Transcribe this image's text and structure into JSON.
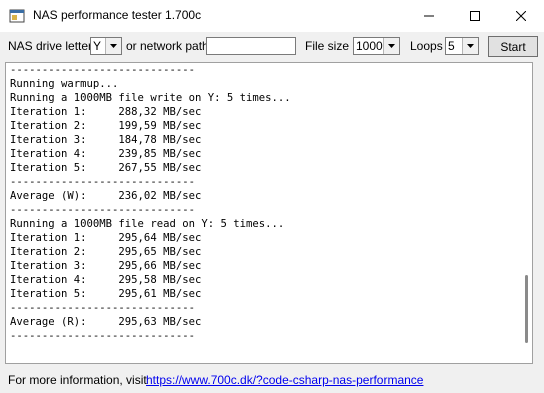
{
  "window": {
    "title": "NAS performance tester 1.700c",
    "icons": {
      "app": "app-window-icon",
      "minimize": "minimize-icon",
      "maximize": "maximize-icon",
      "close": "close-icon"
    }
  },
  "toolbar": {
    "drive_label": "NAS drive letter",
    "drive_value": "Y",
    "network_label": "or network path",
    "network_value": "",
    "filesize_label": "File size",
    "filesize_value": "1000",
    "loops_label": "Loops",
    "loops_value": "5",
    "start_label": "Start"
  },
  "output": {
    "text": "-----------------------------\nRunning warmup...\nRunning a 1000MB file write on Y: 5 times...\nIteration 1:     288,32 MB/sec\nIteration 2:     199,59 MB/sec\nIteration 3:     184,78 MB/sec\nIteration 4:     239,85 MB/sec\nIteration 5:     267,55 MB/sec\n-----------------------------\nAverage (W):     236,02 MB/sec\n-----------------------------\nRunning a 1000MB file read on Y: 5 times...\nIteration 1:     295,64 MB/sec\nIteration 2:     295,65 MB/sec\nIteration 3:     295,66 MB/sec\nIteration 4:     295,58 MB/sec\nIteration 5:     295,61 MB/sec\n-----------------------------\nAverage (R):     295,63 MB/sec\n-----------------------------"
  },
  "footer": {
    "info_text": "For more information, visit",
    "link_text": "https://www.700c.dk/?code-csharp-nas-performance"
  },
  "colors": {
    "link": "#0000ee",
    "window_bg": "#f0f0f0"
  }
}
